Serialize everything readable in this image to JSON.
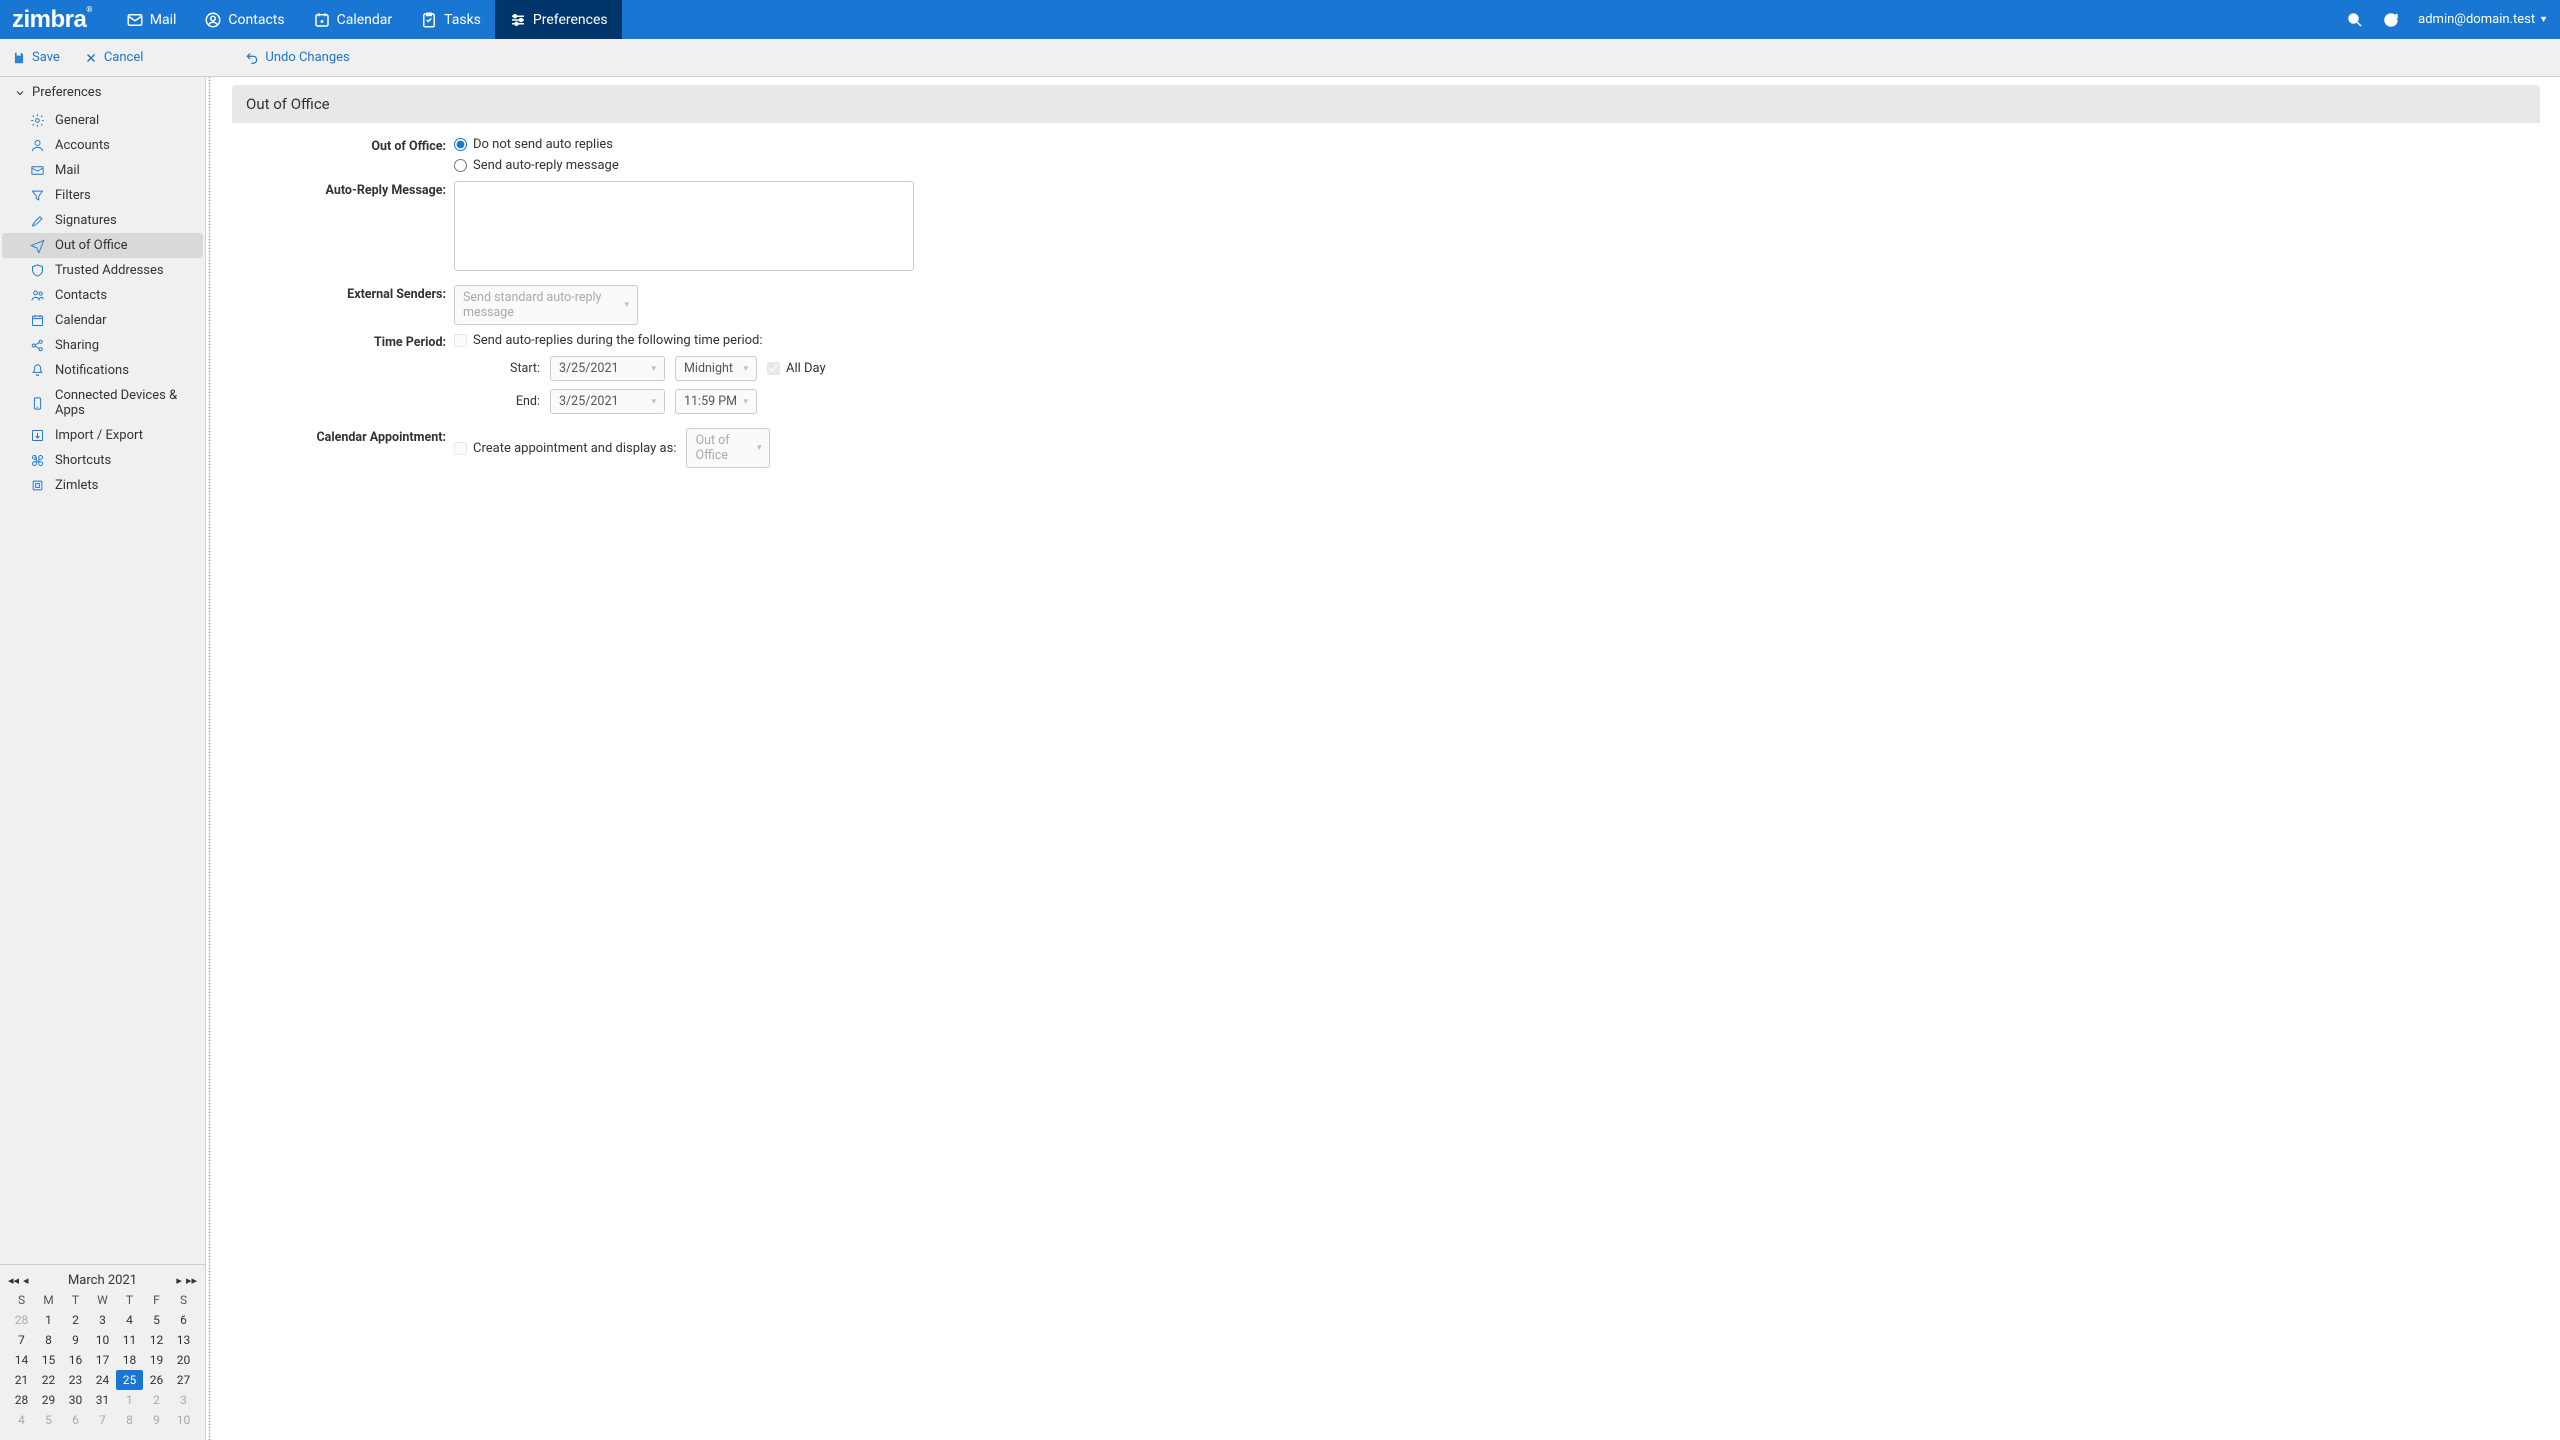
{
  "header": {
    "logo_text": "zimbra",
    "tabs": {
      "mail": "Mail",
      "contacts": "Contacts",
      "calendar": "Calendar",
      "tasks": "Tasks",
      "preferences": "Preferences"
    },
    "user": "admin@domain.test"
  },
  "toolbar": {
    "save": "Save",
    "cancel": "Cancel",
    "undo": "Undo Changes"
  },
  "sidebar": {
    "header": "Preferences",
    "items": {
      "general": "General",
      "accounts": "Accounts",
      "mail": "Mail",
      "filters": "Filters",
      "signatures": "Signatures",
      "ooo": "Out of Office",
      "trusted": "Trusted Addresses",
      "contacts": "Contacts",
      "calendar": "Calendar",
      "sharing": "Sharing",
      "notifications": "Notifications",
      "devices": "Connected Devices & Apps",
      "import": "Import / Export",
      "shortcuts": "Shortcuts",
      "zimlets": "Zimlets"
    }
  },
  "minical": {
    "title": "March 2021",
    "dow": [
      "S",
      "M",
      "T",
      "W",
      "T",
      "F",
      "S"
    ],
    "weeks": [
      [
        {
          "d": "28",
          "o": true
        },
        {
          "d": "1"
        },
        {
          "d": "2"
        },
        {
          "d": "3"
        },
        {
          "d": "4"
        },
        {
          "d": "5"
        },
        {
          "d": "6"
        }
      ],
      [
        {
          "d": "7"
        },
        {
          "d": "8"
        },
        {
          "d": "9"
        },
        {
          "d": "10"
        },
        {
          "d": "11"
        },
        {
          "d": "12"
        },
        {
          "d": "13"
        }
      ],
      [
        {
          "d": "14"
        },
        {
          "d": "15"
        },
        {
          "d": "16"
        },
        {
          "d": "17"
        },
        {
          "d": "18"
        },
        {
          "d": "19"
        },
        {
          "d": "20"
        }
      ],
      [
        {
          "d": "21"
        },
        {
          "d": "22"
        },
        {
          "d": "23"
        },
        {
          "d": "24"
        },
        {
          "d": "25",
          "t": true
        },
        {
          "d": "26"
        },
        {
          "d": "27"
        }
      ],
      [
        {
          "d": "28"
        },
        {
          "d": "29"
        },
        {
          "d": "30"
        },
        {
          "d": "31"
        },
        {
          "d": "1",
          "o": true
        },
        {
          "d": "2",
          "o": true
        },
        {
          "d": "3",
          "o": true
        }
      ],
      [
        {
          "d": "4",
          "o": true
        },
        {
          "d": "5",
          "o": true
        },
        {
          "d": "6",
          "o": true
        },
        {
          "d": "7",
          "o": true
        },
        {
          "d": "8",
          "o": true
        },
        {
          "d": "9",
          "o": true
        },
        {
          "d": "10",
          "o": true
        }
      ]
    ]
  },
  "content": {
    "panel_title": "Out of Office",
    "labels": {
      "ooo": "Out of Office:",
      "auto_msg": "Auto-Reply Message:",
      "ext": "External Senders:",
      "time": "Time Period:",
      "cal": "Calendar Appointment:",
      "start": "Start:",
      "end": "End:"
    },
    "radios": {
      "no_send": "Do not send auto replies",
      "send": "Send auto-reply message"
    },
    "ext_select": "Send standard auto-reply message",
    "time_check": "Send auto-replies during the following time period:",
    "start_date": "3/25/2021",
    "start_time": "Midnight",
    "allday": "All Day",
    "end_date": "3/25/2021",
    "end_time": "11:59 PM",
    "cal_check": "Create appointment and display as:",
    "cal_select": "Out of Office"
  }
}
